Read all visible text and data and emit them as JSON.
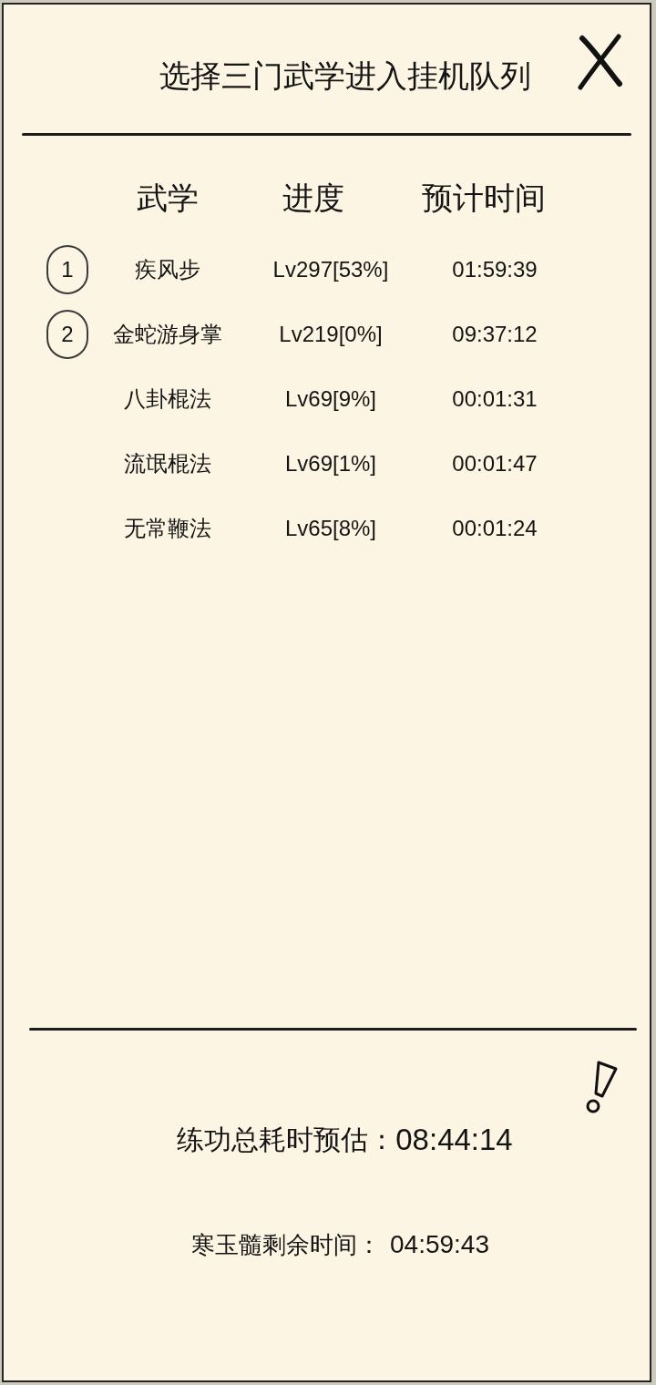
{
  "title": "选择三门武学进入挂机队列",
  "columns": [
    "武学",
    "进度",
    "预计时间"
  ],
  "rows": [
    {
      "queue_number": "1",
      "name": "疾风步",
      "progress": "Lv297[53%]",
      "time": "01:59:39"
    },
    {
      "queue_number": "2",
      "name": "金蛇游身掌",
      "progress": "Lv219[0%]",
      "time": "09:37:12"
    },
    {
      "name": "八卦棍法",
      "progress": "Lv69[9%]",
      "time": "00:01:31"
    },
    {
      "name": "流氓棍法",
      "progress": "Lv69[1%]",
      "time": "00:01:47"
    },
    {
      "name": "无常鞭法",
      "progress": "Lv65[8%]",
      "time": "00:01:24"
    }
  ],
  "total": {
    "label": "练功总耗时预估：",
    "value": "08:44:14"
  },
  "remaining": {
    "label": "寒玉髓剩余时间：",
    "value": "04:59:43"
  }
}
